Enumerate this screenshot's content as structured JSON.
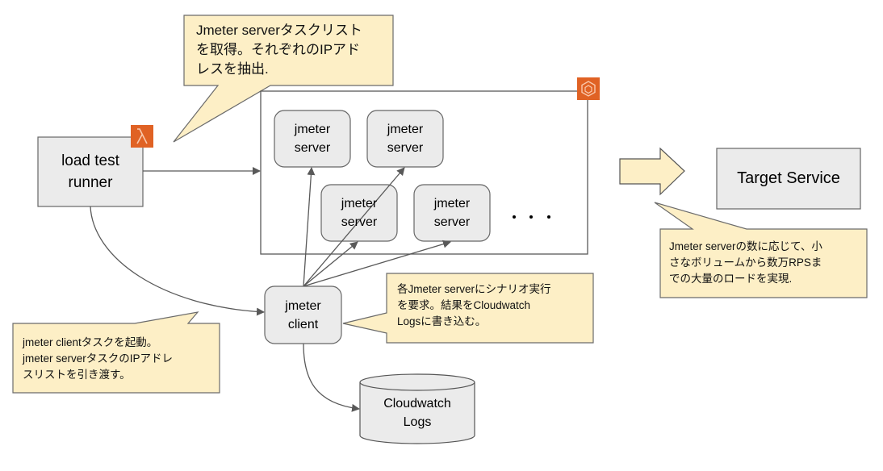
{
  "diagram": {
    "nodes": {
      "load_test_runner": {
        "label": "load test\nrunner",
        "icon": "aws-lambda-icon"
      },
      "ecs_cluster": {
        "icon": "aws-ecs-icon"
      },
      "jmeter_servers": [
        {
          "label": "jmeter\nserver"
        },
        {
          "label": "jmeter\nserver"
        },
        {
          "label": "jmeter\nserver"
        },
        {
          "label": "jmeter\nserver"
        }
      ],
      "ellipsis": "・・・",
      "jmeter_client": {
        "label": "jmeter\nclient"
      },
      "cloudwatch_logs": {
        "label": "Cloudwatch\nLogs"
      },
      "target_service": {
        "label": "Target Service"
      }
    },
    "callouts": {
      "top": "Jmeter serverタスクリスト\nを取得。それぞれのIPアド\nレスを抽出.",
      "client_request": "各Jmeter serverにシナリオ実行\nを要求。結果をCloudwatch\nLogsに書き込む。",
      "launch_client": "jmeter clientタスクを起動。\njmeter serverタスクのIPアドレ\nスリストを引き渡す。",
      "scale": "Jmeter serverの数に応じて、小\nさなボリュームから数万RPSま\nでの大量のロードを実現."
    },
    "colors": {
      "node_fill": "#ebebeb",
      "node_stroke": "#666666",
      "callout_fill": "#fdefc6",
      "callout_stroke": "#6b6b6b",
      "aws_orange": "#e06224",
      "edge": "#595959"
    }
  }
}
